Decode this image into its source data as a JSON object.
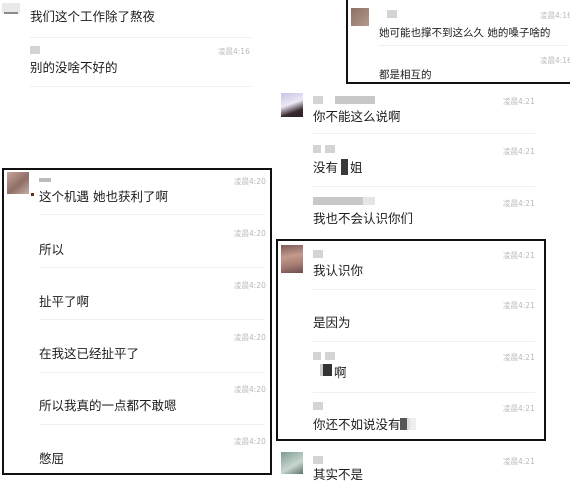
{
  "messages": {
    "m1": {
      "text": "我们这个工作除了熬夜"
    },
    "m2": {
      "time": "凌晨4:16",
      "text": "别的没啥不好的"
    },
    "m3": {
      "time": "凌晨4:16",
      "text": "她可能也撑不到这么久 她的嗓子啥的"
    },
    "m4": {
      "time": "凌晨4:16",
      "text": "都是相互的"
    },
    "m5": {
      "time": "凌晨4:21",
      "text": "你不能这么说啊"
    },
    "m6": {
      "time": "凌晨4:21",
      "text_a": "没有",
      "text_b": "姐"
    },
    "m7": {
      "time": "凌晨4:21",
      "text": "我也不会认识你们"
    },
    "m8": {
      "time": "凌晨4:21",
      "text": "我认识你"
    },
    "m9": {
      "time": "凌晨4:21",
      "text": "是因为"
    },
    "m10": {
      "time": "凌晨4:21",
      "text": "啊"
    },
    "m11": {
      "time": "凌晨4:21",
      "text": "你还不如说没有"
    },
    "m12": {
      "time": "凌晨4:21",
      "text": "其实不是"
    },
    "l1": {
      "time": "凌晨4:20",
      "text": "这个机遇 她也获利了啊"
    },
    "l2": {
      "time": "凌晨4:20",
      "text": "所以"
    },
    "l3": {
      "time": "凌晨4:20",
      "text": "扯平了啊"
    },
    "l4": {
      "time": "凌晨4:20",
      "text": "在我这已经扯平了"
    },
    "l5": {
      "time": "凌晨4:20",
      "text": "所以我真的一点都不敢嗯"
    },
    "l6": {
      "time": "凌晨4:20",
      "text": "憋屈"
    }
  },
  "colors": {
    "frame": "#111111",
    "timestamp": "#b9b9b9",
    "text": "#1c1c1c"
  }
}
